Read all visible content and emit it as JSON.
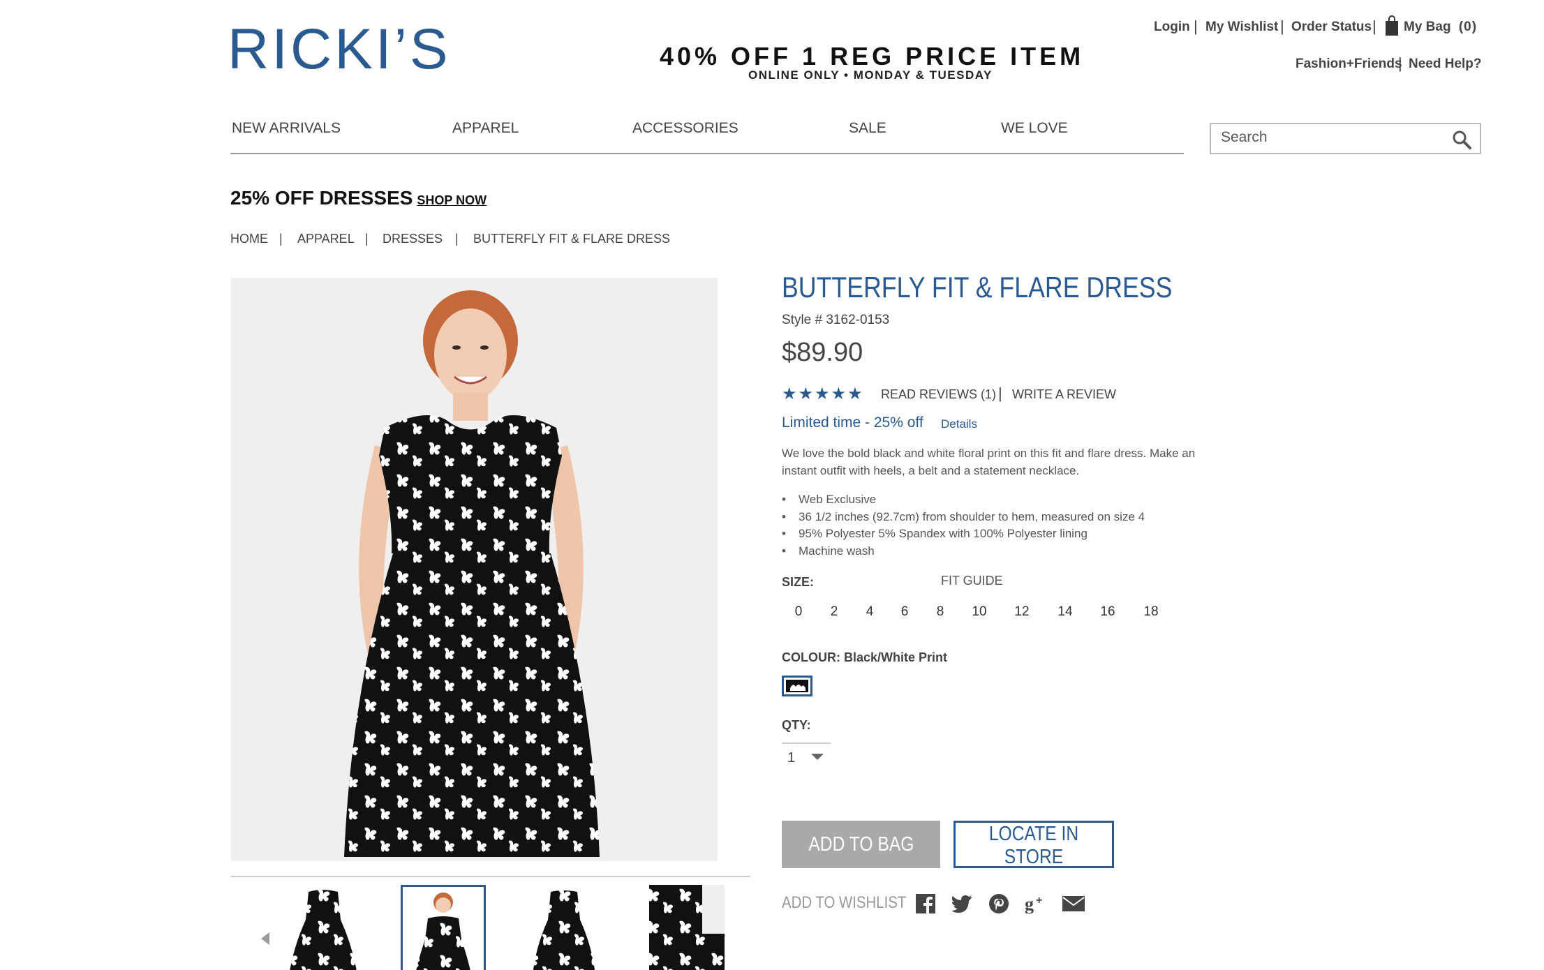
{
  "header": {
    "logo": "RICKI’S",
    "promo_main": "40% OFF 1 REG PRICE ITEM",
    "promo_sub": "ONLINE ONLY • MONDAY & TUESDAY",
    "util_links": [
      "Login",
      "My Wishlist",
      "Order Status",
      "My Bag",
      "Fashion+Friends",
      "Need Help?"
    ],
    "bag_count": "(0)"
  },
  "nav": {
    "items": [
      "NEW ARRIVALS",
      "APPAREL",
      "ACCESSORIES",
      "SALE",
      "WE LOVE"
    ],
    "search_placeholder": "Search"
  },
  "promo": {
    "text": "25% OFF DRESSES",
    "link": "SHOP NOW"
  },
  "breadcrumb": [
    "HOME",
    "APPAREL",
    "DRESSES",
    "BUTTERFLY FIT & FLARE DRESS"
  ],
  "product": {
    "title": "BUTTERFLY FIT & FLARE DRESS",
    "style": "Style # 3162-0153",
    "price": "$89.90",
    "rating": 5,
    "stars": "★★★★★",
    "read_reviews": "READ REVIEWS (1)",
    "write_review": "WRITE A REVIEW",
    "limited": "Limited time - 25% off",
    "details": "Details",
    "description": "We love the bold black and white floral print on this fit and flare dress. Make an instant outfit with heels, a belt and a statement necklace.",
    "bullets": [
      "Web Exclusive",
      "36 1/2 inches (92.7cm) from shoulder to hem, measured on size 4",
      "95% Polyester 5% Spandex with 100% Polyester lining",
      "Machine wash"
    ],
    "size_label": "SIZE:",
    "fit_guide": "FIT GUIDE",
    "sizes": [
      "0",
      "2",
      "4",
      "6",
      "8",
      "10",
      "12",
      "14",
      "16",
      "18"
    ],
    "colour_label": "COLOUR: Black/White Print",
    "qty_label": "QTY:",
    "qty_value": "1",
    "add_to_bag": "ADD TO BAG",
    "locate": "LOCATE IN STORE",
    "add_wishlist": "ADD TO WISHLIST"
  },
  "colors": {
    "brand": "#2a5a8f",
    "button_grey": "#a9a9a9"
  },
  "social_icons": [
    "facebook-icon",
    "twitter-icon",
    "pinterest-icon",
    "google-plus-icon",
    "email-icon"
  ]
}
